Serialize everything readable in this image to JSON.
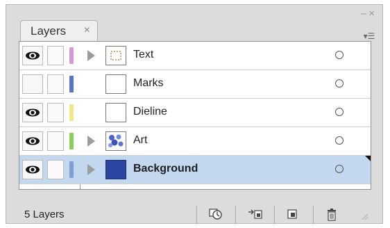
{
  "panel": {
    "tab_label": "Layers",
    "tab_close": "×",
    "window_controls": "–×",
    "menu_glyph": "▾☰"
  },
  "layers": [
    {
      "name": "Text",
      "visible": true,
      "color": "#d49ad8",
      "expandable": true,
      "thumb": "text",
      "selected": false
    },
    {
      "name": "Marks",
      "visible": false,
      "color": "#5b73c7",
      "expandable": false,
      "thumb": "blank",
      "selected": false
    },
    {
      "name": "Dieline",
      "visible": true,
      "color": "#f3e58a",
      "expandable": false,
      "thumb": "blank",
      "selected": false
    },
    {
      "name": "Art",
      "visible": true,
      "color": "#8ccc5a",
      "expandable": true,
      "thumb": "art",
      "selected": false
    },
    {
      "name": "Background",
      "visible": true,
      "color": "#7f9fd6",
      "expandable": true,
      "thumb": "bg",
      "selected": true
    }
  ],
  "footer": {
    "count_label": "5 Layers"
  },
  "icons": [
    "eye-icon",
    "expand-arrow-icon",
    "target-icon",
    "make-clipping-mask-icon",
    "create-sublayer-icon",
    "new-layer-icon",
    "trash-icon"
  ]
}
